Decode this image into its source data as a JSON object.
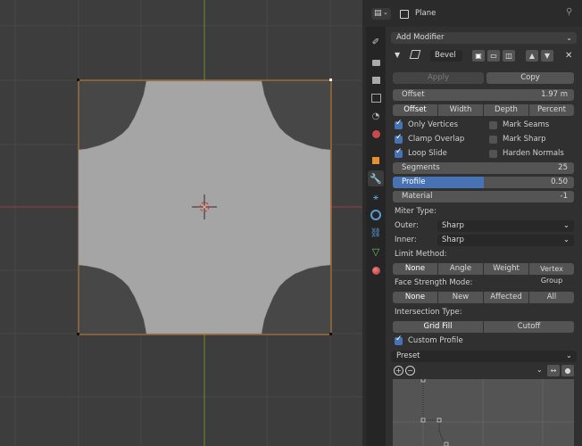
{
  "header": {
    "object_name": "Plane"
  },
  "add_modifier": {
    "label": "Add Modifier"
  },
  "modifier": {
    "name": "Bevel",
    "apply_label": "Apply",
    "copy_label": "Copy",
    "offset": {
      "label": "Offset",
      "value": "1.97 m"
    },
    "width_types": [
      "Offset",
      "Width",
      "Depth",
      "Percent"
    ],
    "only_vertices": "Only Vertices",
    "clamp_overlap": "Clamp Overlap",
    "loop_slide": "Loop Slide",
    "mark_seams": "Mark Seams",
    "mark_sharp": "Mark Sharp",
    "harden_normals": "Harden Normals",
    "segments": {
      "label": "Segments",
      "value": "25"
    },
    "profile": {
      "label": "Profile",
      "value": "0.50",
      "fraction": 0.5
    },
    "material": {
      "label": "Material",
      "value": "-1"
    },
    "miter_type_label": "Miter Type:",
    "outer_label": "Outer:",
    "outer_value": "Sharp",
    "inner_label": "Inner:",
    "inner_value": "Sharp",
    "limit_method_label": "Limit Method:",
    "limit_methods": [
      "None",
      "Angle",
      "Weight",
      "Vertex Group"
    ],
    "face_strength_label": "Face Strength Mode:",
    "face_strength": [
      "None",
      "New",
      "Affected",
      "All"
    ],
    "intersection_label": "Intersection Type:",
    "intersection": [
      "Grid Fill",
      "Cutoff"
    ],
    "custom_profile": "Custom Profile",
    "preset": "Preset"
  },
  "colors": {
    "accent": "#4772b3",
    "selection_outline": "#e8902a",
    "x_axis": "#9b3b4a",
    "y_axis": "#6e8c2c"
  }
}
